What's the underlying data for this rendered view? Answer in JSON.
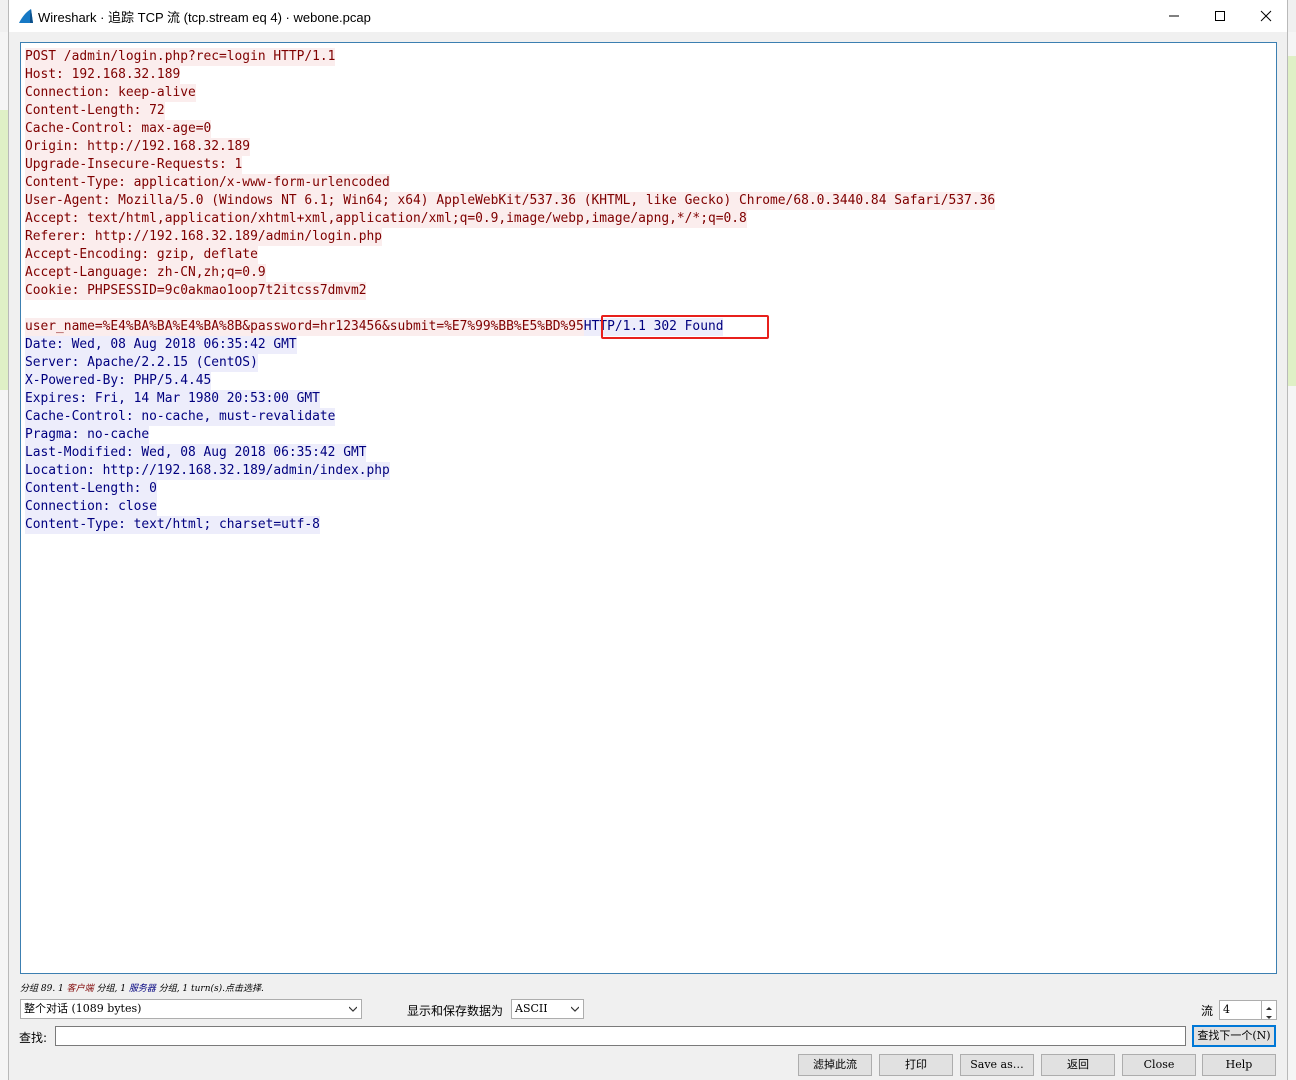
{
  "window": {
    "title": "Wireshark · 追踪 TCP 流 (tcp.stream eq 4) · webone.pcap"
  },
  "stream": {
    "lines": [
      {
        "who": "client",
        "text": "POST /admin/login.php?rec=login HTTP/1.1"
      },
      {
        "who": "client",
        "text": "Host: 192.168.32.189"
      },
      {
        "who": "client",
        "text": "Connection: keep-alive"
      },
      {
        "who": "client",
        "text": "Content-Length: 72"
      },
      {
        "who": "client",
        "text": "Cache-Control: max-age=0"
      },
      {
        "who": "client",
        "text": "Origin: http://192.168.32.189"
      },
      {
        "who": "client",
        "text": "Upgrade-Insecure-Requests: 1"
      },
      {
        "who": "client",
        "text": "Content-Type: application/x-www-form-urlencoded"
      },
      {
        "who": "client",
        "text": "User-Agent: Mozilla/5.0 (Windows NT 6.1; Win64; x64) AppleWebKit/537.36 (KHTML, like Gecko) Chrome/68.0.3440.84 Safari/537.36"
      },
      {
        "who": "client",
        "text": "Accept: text/html,application/xhtml+xml,application/xml;q=0.9,image/webp,image/apng,*/*;q=0.8"
      },
      {
        "who": "client",
        "text": "Referer: http://192.168.32.189/admin/login.php"
      },
      {
        "who": "client",
        "text": "Accept-Encoding: gzip, deflate"
      },
      {
        "who": "client",
        "text": "Accept-Language: zh-CN,zh;q=0.9"
      },
      {
        "who": "client",
        "text": "Cookie: PHPSESSID=9c0akmao1oop7t2itcss7dmvm2"
      },
      {
        "who": "client",
        "text": ""
      },
      {
        "who": "mixed",
        "client_text": "user_name=%E4%BA%BA%E4%BA%8B&password=hr123456&submit=%E7%99%BB%E5%BD%95",
        "server_text": "HTTP/1.1 302 Found"
      },
      {
        "who": "server",
        "text": "Date: Wed, 08 Aug 2018 06:35:42 GMT"
      },
      {
        "who": "server",
        "text": "Server: Apache/2.2.15 (CentOS)"
      },
      {
        "who": "server",
        "text": "X-Powered-By: PHP/5.4.45"
      },
      {
        "who": "server",
        "text": "Expires: Fri, 14 Mar 1980 20:53:00 GMT"
      },
      {
        "who": "server",
        "text": "Cache-Control: no-cache, must-revalidate"
      },
      {
        "who": "server",
        "text": "Pragma: no-cache"
      },
      {
        "who": "server",
        "text": "Last-Modified: Wed, 08 Aug 2018 06:35:42 GMT"
      },
      {
        "who": "server",
        "text": "Location: http://192.168.32.189/admin/index.php"
      },
      {
        "who": "server",
        "text": "Content-Length: 0"
      },
      {
        "who": "server",
        "text": "Connection: close"
      },
      {
        "who": "server",
        "text": "Content-Type: text/html; charset=utf-8"
      }
    ]
  },
  "summary": {
    "prefix": "分组 89. 1 ",
    "client_label": "客户端",
    "middle": " 分组, 1 ",
    "server_label": "服务器",
    "suffix": " 分组, 1 turn(s).点击选择."
  },
  "controls": {
    "conversation_select": "整个对话 (1089 bytes)",
    "display_label": "显示和保存数据为",
    "format_select": "ASCII",
    "stream_label": "流",
    "stream_value": "4",
    "find_label": "查找:",
    "find_value": "",
    "find_next": "查找下一个(N)"
  },
  "buttons": {
    "filter_out": "滤掉此流",
    "print": "打印",
    "save_as": "Save as…",
    "back": "返回",
    "close": "Close",
    "help": "Help"
  },
  "colors": {
    "client_fg": "#7f0000",
    "client_bg": "#fbeded",
    "server_fg": "#00007f",
    "server_bg": "#ededfb",
    "highlight": "#e8201c"
  }
}
